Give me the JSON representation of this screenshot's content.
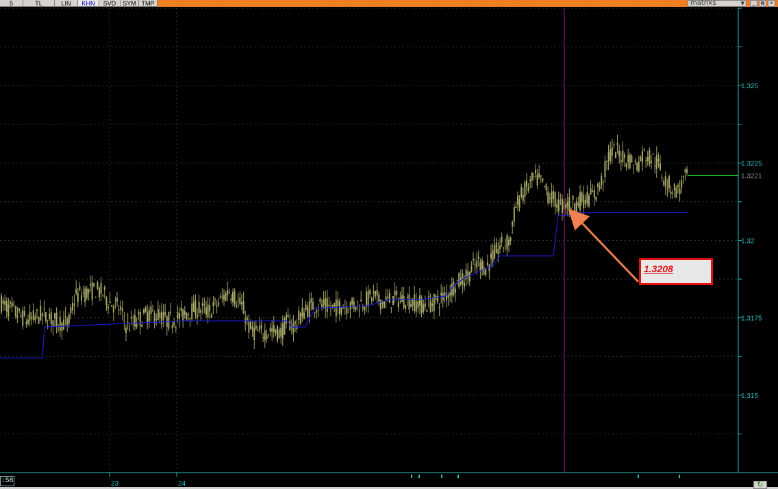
{
  "toolbar": {
    "buttons": [
      {
        "label": "5",
        "active": false
      },
      {
        "label": "TL",
        "active": false
      },
      {
        "label": "LIN",
        "active": false
      },
      {
        "label": "KHN",
        "active": true
      },
      {
        "label": "SVD",
        "active": false
      },
      {
        "label": "SYM",
        "active": false
      },
      {
        "label": "TMP",
        "active": false
      }
    ],
    "brand": "matriks",
    "brand_dropdown": "▼",
    "window_controls": [
      "_",
      "⧉",
      "×"
    ]
  },
  "status": {
    "time": ":58",
    "refresh_icon": "↻"
  },
  "annotation": {
    "label": "1.3208",
    "color": "#e01010",
    "arrow_color": "#f08050"
  },
  "chart_data": {
    "type": "candlestick",
    "ylim": [
      1.3125,
      1.3275
    ],
    "y_ticks": [
      "1.325",
      "1.3225",
      "1.32",
      "1.3175",
      "1.315"
    ],
    "last_price": "1.3221",
    "x_labels": [
      "23",
      "24"
    ],
    "colors": {
      "candles": "#a8a868",
      "stop_line": "#1a1acc",
      "cursor_line": "#a01a8a",
      "axis": "#30c0c0",
      "grid": "#3a3a3a",
      "last_price_line": "#22cc22"
    },
    "price_path": [
      [
        0,
        1.318
      ],
      [
        20,
        1.3177
      ],
      [
        40,
        1.3174
      ],
      [
        60,
        1.3176
      ],
      [
        80,
        1.3174
      ],
      [
        100,
        1.3173
      ],
      [
        110,
        1.3182
      ],
      [
        125,
        1.3183
      ],
      [
        140,
        1.3184
      ],
      [
        150,
        1.3183
      ],
      [
        160,
        1.318
      ],
      [
        175,
        1.3178
      ],
      [
        185,
        1.3172
      ],
      [
        200,
        1.3174
      ],
      [
        215,
        1.3176
      ],
      [
        230,
        1.3176
      ],
      [
        245,
        1.3174
      ],
      [
        260,
        1.3175
      ],
      [
        275,
        1.3177
      ],
      [
        290,
        1.3178
      ],
      [
        305,
        1.3177
      ],
      [
        320,
        1.318
      ],
      [
        335,
        1.3184
      ],
      [
        345,
        1.3181
      ],
      [
        355,
        1.3178
      ],
      [
        365,
        1.3171
      ],
      [
        380,
        1.317
      ],
      [
        395,
        1.3171
      ],
      [
        410,
        1.317
      ],
      [
        420,
        1.3174
      ],
      [
        430,
        1.3172
      ],
      [
        440,
        1.3176
      ],
      [
        455,
        1.3179
      ],
      [
        470,
        1.3179
      ],
      [
        485,
        1.3178
      ],
      [
        500,
        1.3179
      ],
      [
        515,
        1.3179
      ],
      [
        530,
        1.318
      ],
      [
        545,
        1.3182
      ],
      [
        560,
        1.318
      ],
      [
        575,
        1.3181
      ],
      [
        590,
        1.3181
      ],
      [
        605,
        1.318
      ],
      [
        620,
        1.3179
      ],
      [
        635,
        1.318
      ],
      [
        650,
        1.3182
      ],
      [
        665,
        1.3186
      ],
      [
        680,
        1.3188
      ],
      [
        690,
        1.3191
      ],
      [
        700,
        1.3193
      ],
      [
        710,
        1.3191
      ],
      [
        720,
        1.3195
      ],
      [
        730,
        1.3198
      ],
      [
        745,
        1.32
      ],
      [
        752,
        1.321
      ],
      [
        760,
        1.3214
      ],
      [
        770,
        1.3217
      ],
      [
        780,
        1.322
      ],
      [
        790,
        1.3219
      ],
      [
        800,
        1.3215
      ],
      [
        810,
        1.3213
      ],
      [
        820,
        1.3211
      ],
      [
        830,
        1.3212
      ],
      [
        840,
        1.3212
      ],
      [
        850,
        1.3213
      ],
      [
        860,
        1.3214
      ],
      [
        870,
        1.3215
      ],
      [
        880,
        1.322
      ],
      [
        890,
        1.3228
      ],
      [
        900,
        1.3229
      ],
      [
        910,
        1.3227
      ],
      [
        920,
        1.3226
      ],
      [
        930,
        1.3224
      ],
      [
        940,
        1.3228
      ],
      [
        950,
        1.3227
      ],
      [
        960,
        1.3225
      ],
      [
        970,
        1.322
      ],
      [
        980,
        1.3217
      ],
      [
        990,
        1.3216
      ],
      [
        1000,
        1.322
      ],
      [
        1005,
        1.3221
      ]
    ],
    "stop_steps": [
      [
        0,
        1.3162
      ],
      [
        62,
        1.3162
      ],
      [
        65,
        1.3172
      ],
      [
        270,
        1.3174
      ],
      [
        420,
        1.3174
      ],
      [
        425,
        1.3172
      ],
      [
        445,
        1.3172
      ],
      [
        460,
        1.3178
      ],
      [
        540,
        1.3179
      ],
      [
        570,
        1.3181
      ],
      [
        620,
        1.3181
      ],
      [
        650,
        1.3182
      ],
      [
        665,
        1.3186
      ],
      [
        680,
        1.3188
      ],
      [
        700,
        1.319
      ],
      [
        720,
        1.3192
      ],
      [
        730,
        1.3195
      ],
      [
        745,
        1.3195
      ],
      [
        808,
        1.3195
      ],
      [
        815,
        1.3208
      ],
      [
        840,
        1.3208
      ],
      [
        845,
        1.3209
      ],
      [
        1005,
        1.3209
      ]
    ]
  }
}
